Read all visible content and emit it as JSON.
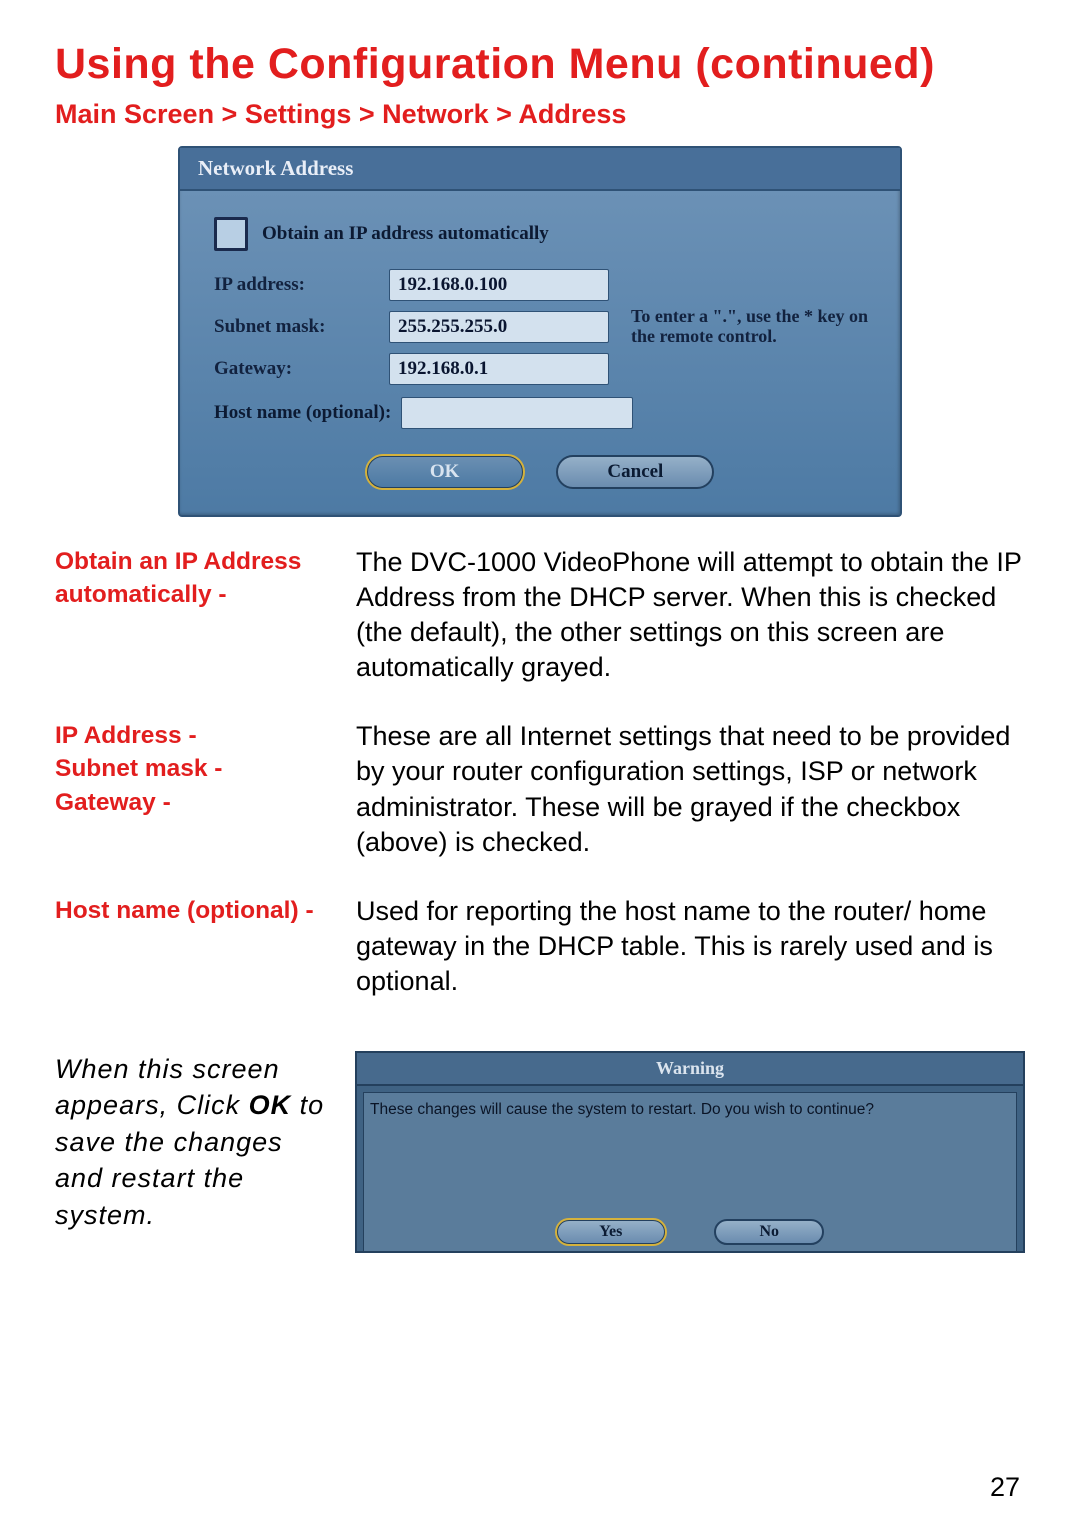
{
  "title": "Using the Configuration Menu (continued)",
  "breadcrumb": "Main Screen > Settings > Network > Address",
  "dialog": {
    "header": "Network Address",
    "auto_label": "Obtain an IP address automatically",
    "rows": {
      "ip_label": "IP address:",
      "ip_value": "192.168.0.100",
      "mask_label": "Subnet mask:",
      "mask_value": "255.255.255.0",
      "gw_label": "Gateway:",
      "gw_value": "192.168.0.1"
    },
    "hint": "To enter a \".\", use the * key on the remote control.",
    "host_label": "Host name (optional):",
    "ok": "OK",
    "cancel": "Cancel"
  },
  "descriptions": [
    {
      "term": "Obtain an IP Address automatically -",
      "text": "The DVC-1000 VideoPhone will attempt to obtain the IP Address from the DHCP server. When this is checked (the default), the other settings on this screen are automatically grayed."
    },
    {
      "term": "IP Address -\nSubnet mask -\nGateway -",
      "text": "These are all Internet settings that need to be provided by your router configuration settings, ISP or network administrator. These will be grayed if the checkbox (above) is checked."
    },
    {
      "term": "Host name (optional) -",
      "text": "Used for reporting the host name to the router/ home gateway in the DHCP table.  This is rarely used and is optional."
    }
  ],
  "bottom_caption_pre": "When this screen appears, Click ",
  "bottom_caption_bold": "OK",
  "bottom_caption_post": " to save the changes and restart the system.",
  "warning": {
    "title": "Warning",
    "message": "These changes will cause the system to restart.  Do you wish to continue?",
    "yes": "Yes",
    "no": "No"
  },
  "page_number": "27"
}
